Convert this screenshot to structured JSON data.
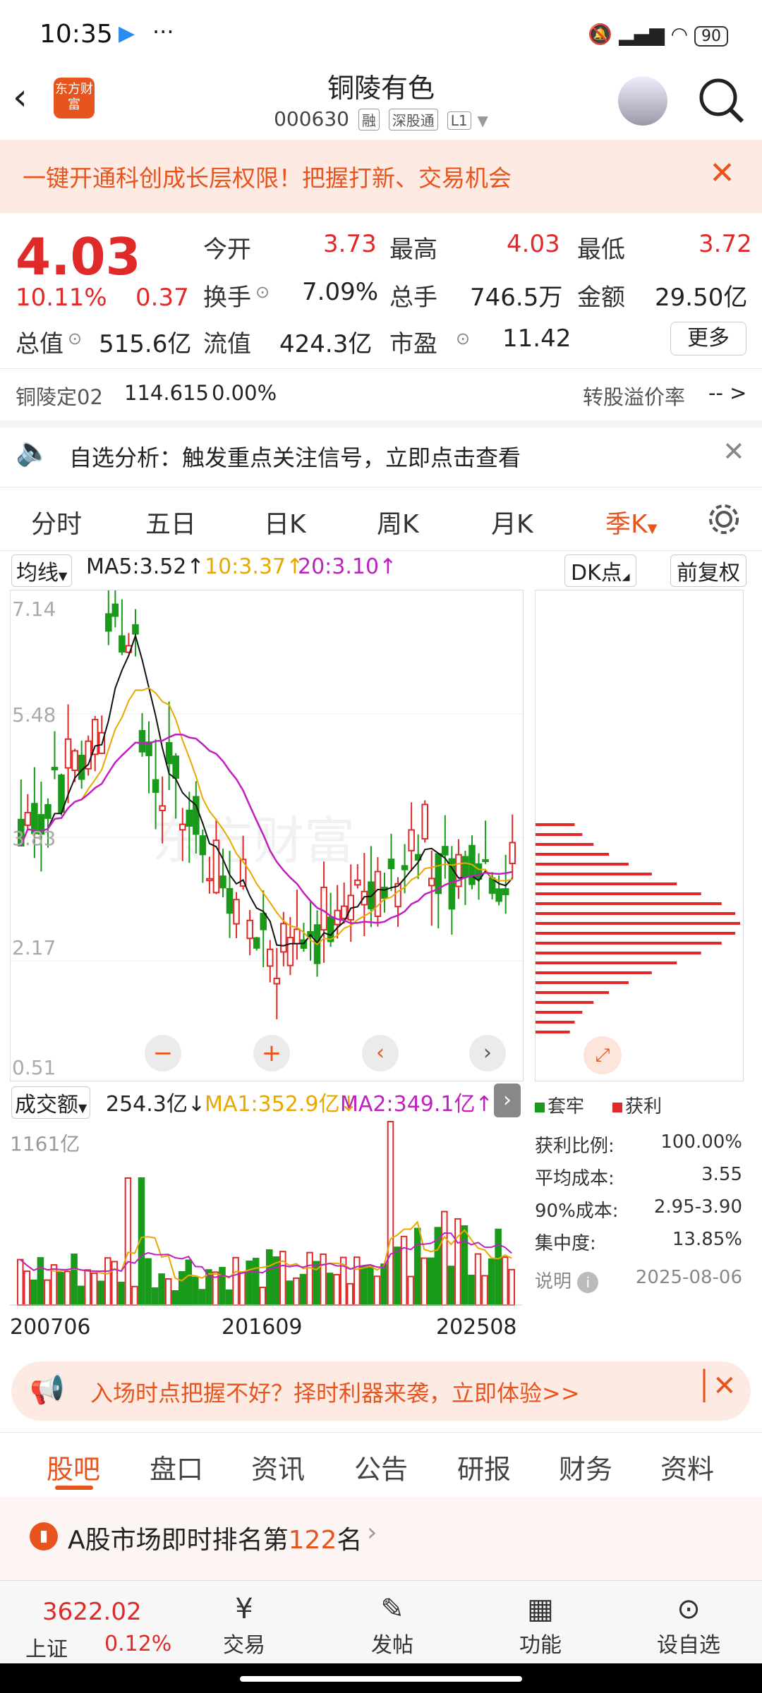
{
  "status_bar": {
    "time": "10:35",
    "battery": "90"
  },
  "header": {
    "title": "铜陵有色",
    "code": "000630",
    "tags": [
      "融",
      "深股通",
      "L1"
    ],
    "logo": "东方财富"
  },
  "banner": {
    "text": "一键开通科创成长层权限！把握打新、交易机会"
  },
  "quote": {
    "price": "4.03",
    "change_pct": "10.11%",
    "change": "0.37",
    "open_label": "今开",
    "open": "3.73",
    "high_label": "最高",
    "high": "4.03",
    "low_label": "最低",
    "low": "3.72",
    "turnover_label": "换手",
    "turnover": "7.09%",
    "volume_label": "总手",
    "volume": "746.5万",
    "amount_label": "金额",
    "amount": "29.50亿",
    "mktcap_label": "总值",
    "mktcap": "515.6亿",
    "float_label": "流值",
    "float": "424.3亿",
    "pe_label": "市盈",
    "pe": "11.42",
    "more": "更多"
  },
  "convertible": {
    "name": "铜陵定02",
    "price": "114.615",
    "pct": "0.00%",
    "premium_label": "转股溢价率",
    "premium": "-- >"
  },
  "analysis": {
    "text": "自选分析：触发重点关注信号，立即点击查看"
  },
  "tabs": [
    "分时",
    "五日",
    "日K",
    "周K",
    "月K",
    "季K"
  ],
  "ma_row": {
    "type": "均线",
    "ma5": "MA5:3.52↑",
    "ma10": "10:3.37↑",
    "ma20": "20:3.10↑",
    "dk": "DK点",
    "fq": "前复权"
  },
  "chart_ticks": [
    "7.14",
    "5.48",
    "3.83",
    "2.17",
    "0.51"
  ],
  "watermark": "东方财富",
  "vol_row": {
    "type": "成交额",
    "val": "254.3亿↓",
    "ma1": "MA1:352.9亿↓",
    "ma2": "MA2:349.1亿↑"
  },
  "vol_top": "1161亿",
  "x_labels": [
    "200706",
    "201609",
    "202508"
  ],
  "dk_legend": {
    "trapped": "套牢",
    "profit": "获利"
  },
  "stats": [
    {
      "label": "获利比例:",
      "value": "100.00%"
    },
    {
      "label": "平均成本:",
      "value": "3.55"
    },
    {
      "label": "90%成本:",
      "value": "2.95-3.90"
    },
    {
      "label": "集中度:",
      "value": "13.85%"
    }
  ],
  "note": {
    "label": "说明",
    "date": "2025-08-06"
  },
  "promo": {
    "text": "入场时点把握不好？择时利器来袭，立即体验>>"
  },
  "bottom_tabs": [
    "股吧",
    "盘口",
    "资讯",
    "公告",
    "研报",
    "财务",
    "资料"
  ],
  "rank": {
    "prefix": "A股市场即时排名第",
    "num": "122",
    "suffix": "名"
  },
  "index": {
    "value": "3622.02",
    "name": "上证",
    "pct": "0.12%"
  },
  "nav": [
    "交易",
    "发帖",
    "功能",
    "设自选"
  ],
  "colors": {
    "accent": "#e8541e",
    "up": "#e02a2a",
    "down": "#1a9a1a"
  }
}
